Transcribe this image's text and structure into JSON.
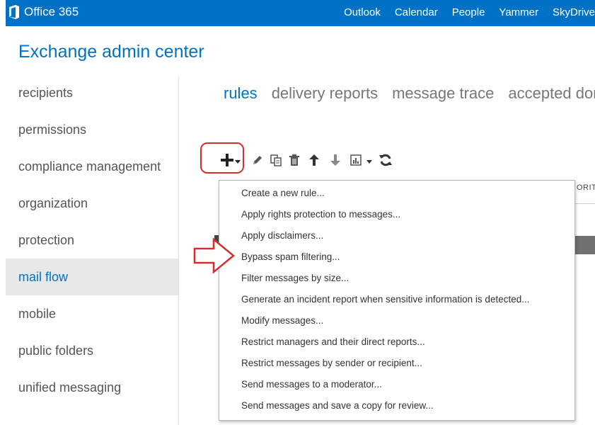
{
  "topbar": {
    "brand": "Office 365",
    "links": [
      "Outlook",
      "Calendar",
      "People",
      "Yammer",
      "SkyDrive"
    ],
    "color": "#0072c6"
  },
  "app": {
    "title": "Exchange admin center"
  },
  "leftnav": {
    "items": [
      {
        "label": "recipients",
        "active": false
      },
      {
        "label": "permissions",
        "active": false
      },
      {
        "label": "compliance management",
        "active": false
      },
      {
        "label": "organization",
        "active": false
      },
      {
        "label": "protection",
        "active": false
      },
      {
        "label": "mail flow",
        "active": true
      },
      {
        "label": "mobile",
        "active": false
      },
      {
        "label": "public folders",
        "active": false
      },
      {
        "label": "unified messaging",
        "active": false
      }
    ]
  },
  "tabs": [
    "rules",
    "delivery reports",
    "message trace",
    "accepted dom"
  ],
  "toolbar": {
    "icons": [
      "add-icon",
      "edit-icon",
      "copy-icon",
      "delete-icon",
      "move-up-icon",
      "move-down-icon",
      "report-icon",
      "refresh-icon"
    ]
  },
  "table": {
    "partial_header": "ORIT"
  },
  "menu": {
    "items": [
      "Create a new rule...",
      "Apply rights protection to messages...",
      "Apply disclaimers...",
      "Bypass spam filtering...",
      "Filter messages by size...",
      "Generate an incident report when sensitive information is detected...",
      "Modify messages...",
      "Restrict managers and their direct reports...",
      "Restrict messages by sender or recipient...",
      "Send messages to a moderator...",
      "Send messages and save a copy for review..."
    ]
  },
  "annotation_color": "#d32f2f"
}
